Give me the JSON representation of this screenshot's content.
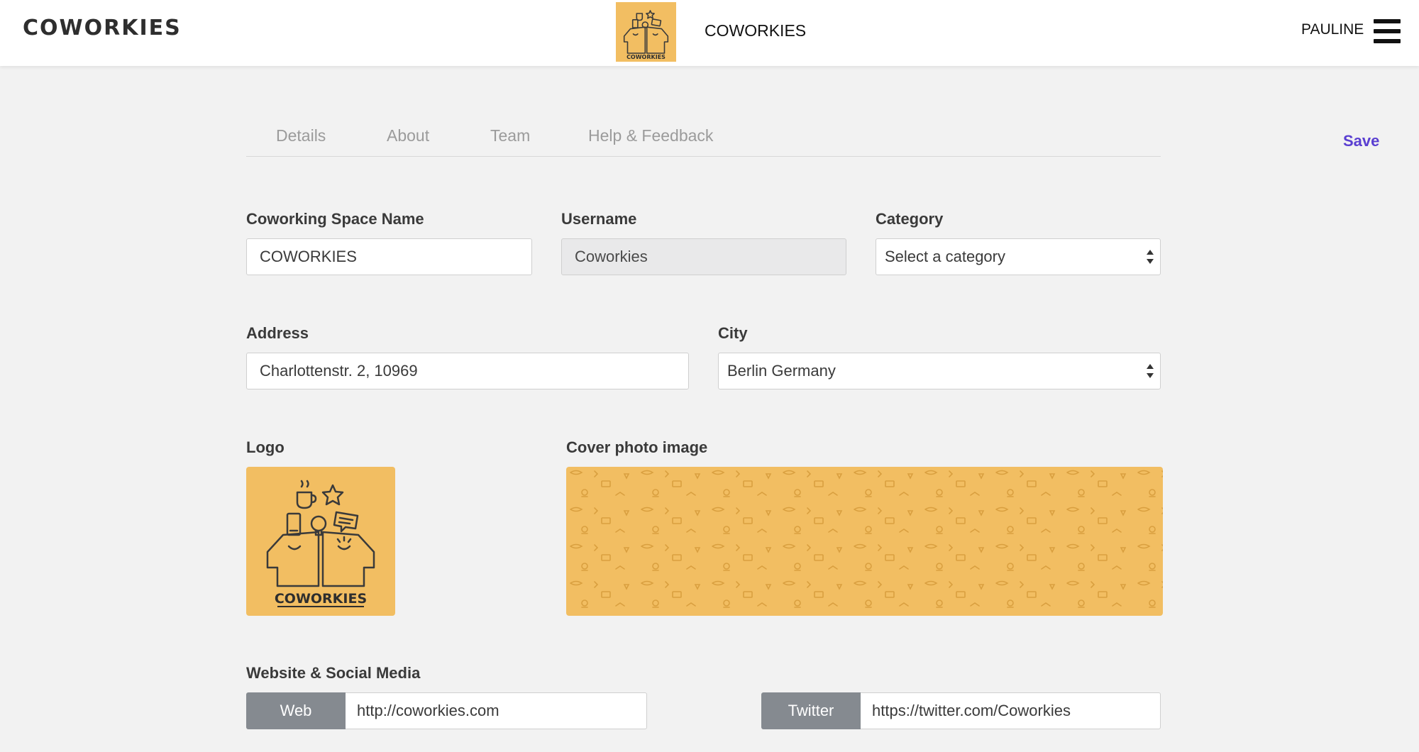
{
  "navbar": {
    "brand": "COWORKIES",
    "logo_caption": "COWORKIES",
    "title": "COWORKIES",
    "user": "PAULINE",
    "menu_icon": "hamburger-menu-icon"
  },
  "tabs": [
    {
      "label": "Details"
    },
    {
      "label": "About"
    },
    {
      "label": "Team"
    },
    {
      "label": "Help & Feedback"
    }
  ],
  "save_label": "Save",
  "form": {
    "space_name": {
      "label": "Coworking Space Name",
      "value": "COWORKIES"
    },
    "username": {
      "label": "Username",
      "value": "Coworkies"
    },
    "category": {
      "label": "Category",
      "value": "Select a category"
    },
    "address": {
      "label": "Address",
      "value": "Charlottenstr. 2, 10969"
    },
    "city": {
      "label": "City",
      "value": "Berlin Germany"
    },
    "logo": {
      "label": "Logo",
      "caption": "COWORKIES"
    },
    "cover": {
      "label": "Cover photo image"
    },
    "social": {
      "label": "Website & Social Media",
      "web": {
        "addon": "Web",
        "value": "http://coworkies.com"
      },
      "twitter": {
        "addon": "Twitter",
        "value": "https://twitter.com/Coworkies"
      }
    }
  },
  "colors": {
    "accent": "#5a3fd1",
    "logo_bg": "#f2be62",
    "addon_bg": "#858a90",
    "page_bg": "#f2f2f2"
  }
}
